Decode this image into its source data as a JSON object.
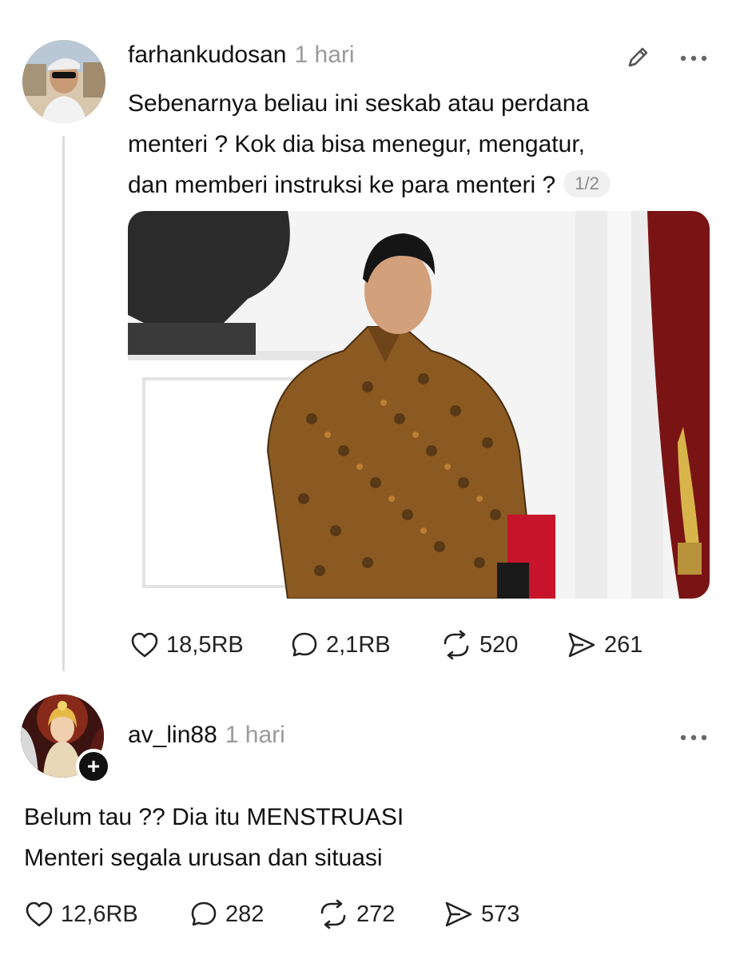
{
  "posts": [
    {
      "username": "farhankudosan",
      "time": "1 hari",
      "text_lines": [
        "Sebenarnya beliau ini seskab atau perdana",
        "menteri ? Kok dia bisa menegur, mengatur,",
        "dan memberi instruksi ke para menteri ?"
      ],
      "page_indicator": "1/2",
      "stats": {
        "likes": "18,5RB",
        "replies": "2,1RB",
        "reposts": "520",
        "shares": "261"
      }
    },
    {
      "username": "av_lin88",
      "time": "1 hari",
      "text_lines": [
        "Belum tau ?? Dia itu MENSTRUASI",
        "Menteri segala urusan dan situasi"
      ],
      "stats": {
        "likes": "12,6RB",
        "replies": "282",
        "reposts": "272",
        "shares": "573"
      }
    }
  ],
  "icons": [
    "pencil-icon",
    "more-icon",
    "heart-icon",
    "comment-icon",
    "repost-icon",
    "share-icon",
    "plus-icon"
  ]
}
